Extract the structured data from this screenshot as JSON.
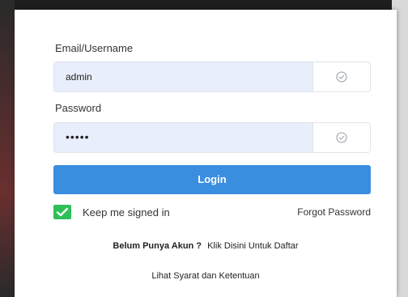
{
  "login_form": {
    "email_label": "Email/Username",
    "email_value": "admin",
    "password_label": "Password",
    "password_value": "•••••",
    "login_button": "Login",
    "remember_label": "Keep me signed in",
    "remember_checked": true,
    "forgot_password": "Forgot Password",
    "register_question": "Belum Punya Akun ?",
    "register_link": "Klik Disini Untuk Daftar",
    "terms_link": "Lihat Syarat dan Ketentuan",
    "icons": {
      "email_addon": "check-circle-icon",
      "password_addon": "check-circle-icon",
      "checkbox": "checkmark-icon"
    },
    "colors": {
      "button": "#3a8ee0",
      "input_fill": "#e9eefc",
      "checkbox": "#2fbf5a"
    }
  }
}
